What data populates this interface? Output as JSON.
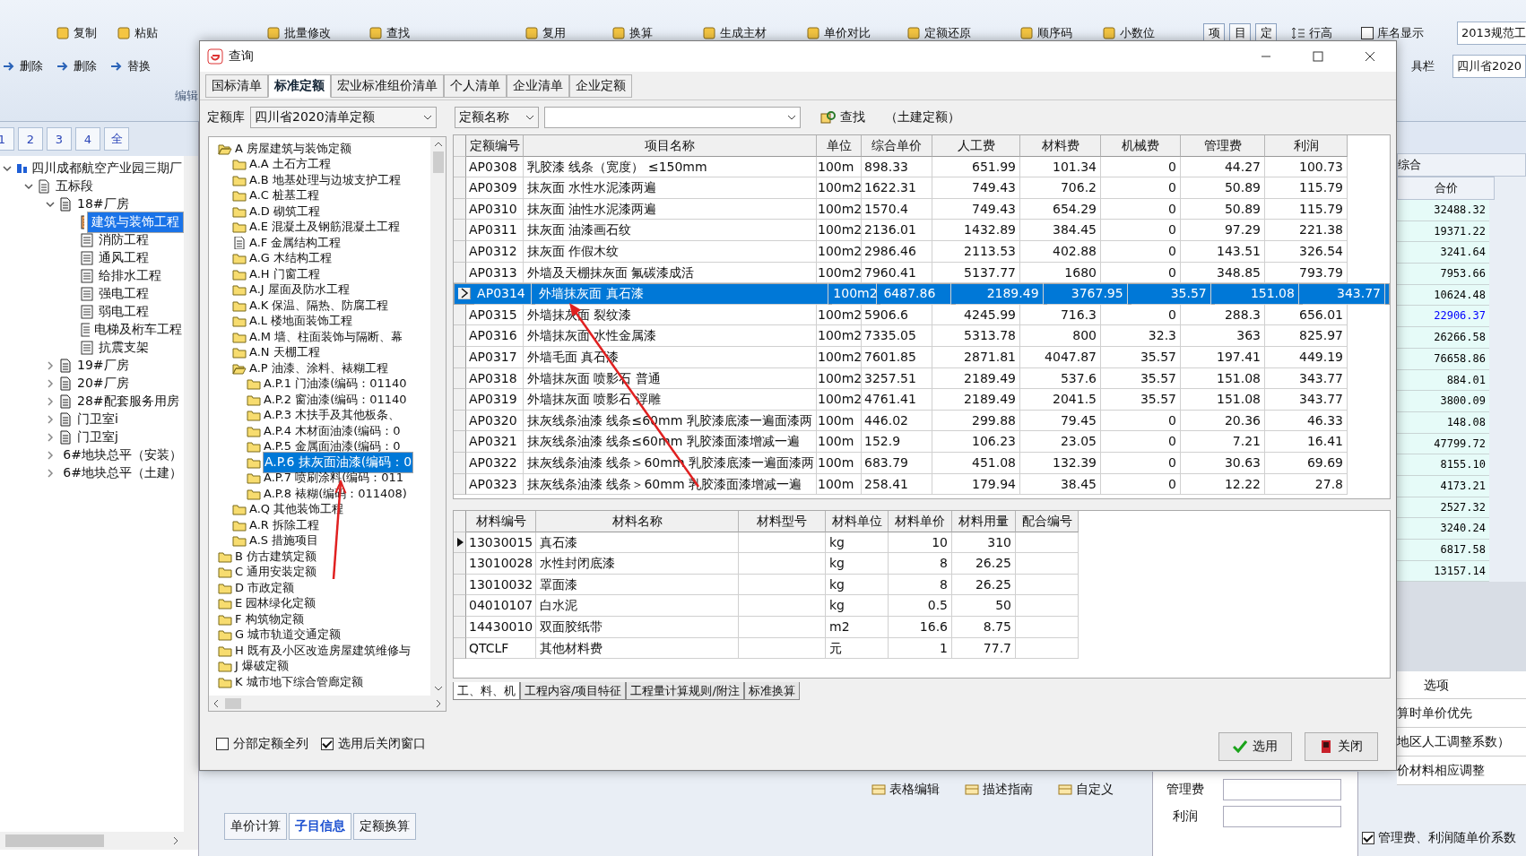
{
  "ribbon": {
    "row1": [
      {
        "label": "复制"
      },
      {
        "label": "粘贴"
      },
      {
        "label": "批量修改"
      },
      {
        "label": "查找"
      },
      {
        "label": "复用"
      },
      {
        "label": "换算"
      },
      {
        "label": "生成主材"
      },
      {
        "label": "单价对比"
      },
      {
        "label": "定额还原"
      },
      {
        "label": "顺序码"
      },
      {
        "label": "小数位"
      }
    ],
    "toggles": [
      "项",
      "目",
      "定"
    ],
    "row_height": "行高",
    "library_name_toggle": {
      "label": "库名显示",
      "checked": false
    },
    "standard_field": "2013规范工",
    "row2_left": [
      {
        "label": "删除"
      },
      {
        "label": "删除"
      },
      {
        "label": "替换"
      }
    ],
    "toolbar_label": "具栏",
    "region_field": "四川省2020",
    "group_label": "编辑"
  },
  "project_panel": {
    "tabs": [
      {
        "label": "1",
        "selected": false
      },
      {
        "label": "2",
        "selected": false
      },
      {
        "label": "3",
        "selected": false
      },
      {
        "label": "4",
        "selected": false
      },
      {
        "label": "全",
        "selected": false
      }
    ],
    "tree": [
      {
        "label": "四川成都航空产业园三期厂",
        "kind": "project",
        "expanded": true,
        "selected": false,
        "children": [
          {
            "label": "五标段",
            "kind": "section",
            "expanded": true,
            "selected": false,
            "children": [
              {
                "label": "18#厂房",
                "kind": "building",
                "expanded": true,
                "selected": false,
                "children": [
                  {
                    "label": "建筑与装饰工程",
                    "kind": "unit",
                    "selected": true
                  },
                  {
                    "label": "消防工程",
                    "kind": "unit",
                    "selected": false
                  },
                  {
                    "label": "通风工程",
                    "kind": "unit",
                    "selected": false
                  },
                  {
                    "label": "给排水工程",
                    "kind": "unit",
                    "selected": false
                  },
                  {
                    "label": "强电工程",
                    "kind": "unit",
                    "selected": false
                  },
                  {
                    "label": "弱电工程",
                    "kind": "unit",
                    "selected": false
                  },
                  {
                    "label": "电梯及桁车工程",
                    "kind": "unit",
                    "selected": false
                  },
                  {
                    "label": "抗震支架",
                    "kind": "unit",
                    "selected": false
                  }
                ]
              },
              {
                "label": "19#厂房",
                "kind": "building",
                "expanded": false,
                "selected": false
              },
              {
                "label": "20#厂房",
                "kind": "building",
                "expanded": false,
                "selected": false
              },
              {
                "label": "28#配套服务用房",
                "kind": "building",
                "expanded": false,
                "selected": false
              },
              {
                "label": "门卫室i",
                "kind": "building",
                "expanded": false,
                "selected": false
              },
              {
                "label": "门卫室j",
                "kind": "building",
                "expanded": false,
                "selected": false
              },
              {
                "label": "6#地块总平（安装）",
                "kind": "building",
                "expanded": false,
                "selected": false
              },
              {
                "label": "6#地块总平（土建）",
                "kind": "building",
                "expanded": false,
                "selected": false
              }
            ]
          }
        ]
      }
    ]
  },
  "summary_panel": {
    "group_header": "综合",
    "column_header": "合价",
    "values": [
      {
        "text": "32488.32",
        "color": "#000000"
      },
      {
        "text": "19371.22",
        "color": "#000000"
      },
      {
        "text": "3241.64",
        "color": "#000000"
      },
      {
        "text": "7953.66",
        "color": "#000000"
      },
      {
        "text": "10624.48",
        "color": "#000000"
      },
      {
        "text": "22906.37",
        "color": "#0000ff"
      },
      {
        "text": "26266.58",
        "color": "#000000"
      },
      {
        "text": "76658.86",
        "color": "#000000"
      },
      {
        "text": "884.01",
        "color": "#000000"
      },
      {
        "text": "3800.09",
        "color": "#000000"
      },
      {
        "text": "148.08",
        "color": "#000000"
      },
      {
        "text": "47799.72",
        "color": "#000000"
      },
      {
        "text": "8155.10",
        "color": "#000000"
      },
      {
        "text": "4173.21",
        "color": "#000000"
      },
      {
        "text": "2527.32",
        "color": "#000000"
      },
      {
        "text": "3240.24",
        "color": "#000000"
      },
      {
        "text": "6817.58",
        "color": "#000000"
      },
      {
        "text": "13157.14",
        "color": "#000000"
      }
    ],
    "options_header": "选项",
    "options": [
      "算时单价优先",
      "地区人工调整系数）",
      "价材料相应调整"
    ],
    "fees": [
      {
        "label": "管理费"
      },
      {
        "label": "利润"
      }
    ],
    "fee_option": {
      "label": "管理费、利润随单价系数",
      "checked": true
    }
  },
  "bottom_toolbar": [
    "表格编辑",
    "描述指南",
    "自定义"
  ],
  "bottom_tabs": [
    {
      "label": "单价计算",
      "selected": false
    },
    {
      "label": "子目信息",
      "selected": true
    },
    {
      "label": "定额换算",
      "selected": false
    }
  ],
  "dialog": {
    "title": "查询",
    "tabs": [
      {
        "label": "国标清单",
        "selected": false
      },
      {
        "label": "标准定额",
        "selected": true
      },
      {
        "label": "宏业标准组价清单",
        "selected": false
      },
      {
        "label": "个人清单",
        "selected": false
      },
      {
        "label": "企业清单",
        "selected": false
      },
      {
        "label": "企业定额",
        "selected": false
      }
    ],
    "library_label": "定额库",
    "library": "四川省2020清单定额",
    "search_by": "定额名称",
    "find_button": "查找",
    "scope": "（土建定额）",
    "tree": [
      {
        "label": "A 房屋建筑与装饰定额",
        "kind": "folder-open",
        "selected": false,
        "children": [
          {
            "label": "A.A 土石方工程",
            "kind": "folder",
            "selected": false
          },
          {
            "label": "A.B 地基处理与边坡支护工程",
            "kind": "folder",
            "selected": false
          },
          {
            "label": "A.C 桩基工程",
            "kind": "folder",
            "selected": false
          },
          {
            "label": "A.D 砌筑工程",
            "kind": "folder",
            "selected": false
          },
          {
            "label": "A.E 混凝土及钢筋混凝土工程",
            "kind": "folder",
            "selected": false
          },
          {
            "label": "A.F 金属结构工程",
            "kind": "document",
            "selected": false
          },
          {
            "label": "A.G 木结构工程",
            "kind": "folder",
            "selected": false
          },
          {
            "label": "A.H 门窗工程",
            "kind": "folder",
            "selected": false
          },
          {
            "label": "A.J 屋面及防水工程",
            "kind": "folder",
            "selected": false
          },
          {
            "label": "A.K 保温、隔热、防腐工程",
            "kind": "folder",
            "selected": false
          },
          {
            "label": "A.L 楼地面装饰工程",
            "kind": "folder",
            "selected": false
          },
          {
            "label": "A.M 墙、柱面装饰与隔断、幕",
            "kind": "folder",
            "selected": false
          },
          {
            "label": "A.N 天棚工程",
            "kind": "folder",
            "selected": false
          },
          {
            "label": "A.P 油漆、涂料、裱糊工程",
            "kind": "folder-open",
            "selected": false,
            "children": [
              {
                "label": "A.P.1 门油漆(编码：01140",
                "kind": "folder",
                "selected": false
              },
              {
                "label": "A.P.2 窗油漆(编码：01140",
                "kind": "folder",
                "selected": false
              },
              {
                "label": "A.P.3 木扶手及其他板条、",
                "kind": "folder",
                "selected": false
              },
              {
                "label": "A.P.4 木材面油漆(编码：0",
                "kind": "folder",
                "selected": false
              },
              {
                "label": "A.P.5 金属面油漆(编码：0",
                "kind": "folder",
                "selected": false
              },
              {
                "label": "A.P.6 抹灰面油漆(编码：0",
                "kind": "folder",
                "selected": true
              },
              {
                "label": "A.P.7 喷刷涂料(编码：011",
                "kind": "folder",
                "selected": false
              },
              {
                "label": "A.P.8 裱糊(编码：011408)",
                "kind": "folder",
                "selected": false
              }
            ]
          },
          {
            "label": "A.Q 其他装饰工程",
            "kind": "folder",
            "selected": false
          },
          {
            "label": "A.R 拆除工程",
            "kind": "folder",
            "selected": false
          },
          {
            "label": "A.S 措施项目",
            "kind": "folder",
            "selected": false
          }
        ]
      },
      {
        "label": "B 仿古建筑定额",
        "kind": "folder",
        "selected": false
      },
      {
        "label": "C 通用安装定额",
        "kind": "folder",
        "selected": false
      },
      {
        "label": "D 市政定额",
        "kind": "folder",
        "selected": false
      },
      {
        "label": "E 园林绿化定额",
        "kind": "folder",
        "selected": false
      },
      {
        "label": "F 构筑物定额",
        "kind": "folder",
        "selected": false
      },
      {
        "label": "G 城市轨道交通定额",
        "kind": "folder",
        "selected": false
      },
      {
        "label": "H 既有及小区改造房屋建筑维修与",
        "kind": "folder",
        "selected": false
      },
      {
        "label": "J 爆破定额",
        "kind": "folder",
        "selected": false
      },
      {
        "label": "K 城市地下综合管廊定额",
        "kind": "folder",
        "selected": false
      }
    ],
    "quota_columns": [
      "定额编号",
      "项目名称",
      "单位",
      "综合单价",
      "人工费",
      "材料费",
      "机械费",
      "管理费",
      "利润"
    ],
    "quota_rows": [
      {
        "code": "AP0308",
        "name": "乳胶漆 线条（宽度） ≤150mm",
        "unit": "100m",
        "price": "898.33",
        "labor": "651.99",
        "material": "101.34",
        "machine": "0",
        "mgmt": "44.27",
        "profit": "100.73",
        "selected": false
      },
      {
        "code": "AP0309",
        "name": "抹灰面 水性水泥漆两遍",
        "unit": "100m2",
        "price": "1622.31",
        "labor": "749.43",
        "material": "706.2",
        "machine": "0",
        "mgmt": "50.89",
        "profit": "115.79",
        "selected": false
      },
      {
        "code": "AP0310",
        "name": "抹灰面 油性水泥漆两遍",
        "unit": "100m2",
        "price": "1570.4",
        "labor": "749.43",
        "material": "654.29",
        "machine": "0",
        "mgmt": "50.89",
        "profit": "115.79",
        "selected": false
      },
      {
        "code": "AP0311",
        "name": "抹灰面 油漆画石纹",
        "unit": "100m2",
        "price": "2136.01",
        "labor": "1432.89",
        "material": "384.45",
        "machine": "0",
        "mgmt": "97.29",
        "profit": "221.38",
        "selected": false
      },
      {
        "code": "AP0312",
        "name": "抹灰面 作假木纹",
        "unit": "100m2",
        "price": "2986.46",
        "labor": "2113.53",
        "material": "402.88",
        "machine": "0",
        "mgmt": "143.51",
        "profit": "326.54",
        "selected": false
      },
      {
        "code": "AP0313",
        "name": "外墙及天棚抹灰面 氟碳漆成活",
        "unit": "100m2",
        "price": "7960.41",
        "labor": "5137.77",
        "material": "1680",
        "machine": "0",
        "mgmt": "348.85",
        "profit": "793.79",
        "selected": false
      },
      {
        "code": "AP0314",
        "name": "外墙抹灰面 真石漆",
        "unit": "100m2",
        "price": "6487.86",
        "labor": "2189.49",
        "material": "3767.95",
        "machine": "35.57",
        "mgmt": "151.08",
        "profit": "343.77",
        "selected": true
      },
      {
        "code": "AP0315",
        "name": "外墙抹灰面 裂纹漆",
        "unit": "100m2",
        "price": "5906.6",
        "labor": "4245.99",
        "material": "716.3",
        "machine": "0",
        "mgmt": "288.3",
        "profit": "656.01",
        "selected": false
      },
      {
        "code": "AP0316",
        "name": "外墙抹灰面 水性金属漆",
        "unit": "100m2",
        "price": "7335.05",
        "labor": "5313.78",
        "material": "800",
        "machine": "32.3",
        "mgmt": "363",
        "profit": "825.97",
        "selected": false
      },
      {
        "code": "AP0317",
        "name": "外墙毛面 真石漆",
        "unit": "100m2",
        "price": "7601.85",
        "labor": "2871.81",
        "material": "4047.87",
        "machine": "35.57",
        "mgmt": "197.41",
        "profit": "449.19",
        "selected": false
      },
      {
        "code": "AP0318",
        "name": "外墙抹灰面 喷影石 普通",
        "unit": "100m2",
        "price": "3257.51",
        "labor": "2189.49",
        "material": "537.6",
        "machine": "35.57",
        "mgmt": "151.08",
        "profit": "343.77",
        "selected": false
      },
      {
        "code": "AP0319",
        "name": "外墙抹灰面 喷影石 浮雕",
        "unit": "100m2",
        "price": "4761.41",
        "labor": "2189.49",
        "material": "2041.5",
        "machine": "35.57",
        "mgmt": "151.08",
        "profit": "343.77",
        "selected": false
      },
      {
        "code": "AP0320",
        "name": "抹灰线条油漆 线条≤60mm 乳胶漆底漆一遍面漆两",
        "unit": "100m",
        "price": "446.02",
        "labor": "299.88",
        "material": "79.45",
        "machine": "0",
        "mgmt": "20.36",
        "profit": "46.33",
        "selected": false
      },
      {
        "code": "AP0321",
        "name": "抹灰线条油漆 线条≤60mm 乳胶漆面漆增减一遍",
        "unit": "100m",
        "price": "152.9",
        "labor": "106.23",
        "material": "23.05",
        "machine": "0",
        "mgmt": "7.21",
        "profit": "16.41",
        "selected": false
      },
      {
        "code": "AP0322",
        "name": "抹灰线条油漆 线条＞60mm 乳胶漆底漆一遍面漆两",
        "unit": "100m",
        "price": "683.79",
        "labor": "451.08",
        "material": "132.39",
        "machine": "0",
        "mgmt": "30.63",
        "profit": "69.69",
        "selected": false
      },
      {
        "code": "AP0323",
        "name": "抹灰线条油漆 线条＞60mm 乳胶漆面漆增减一遍",
        "unit": "100m",
        "price": "258.41",
        "labor": "179.94",
        "material": "38.45",
        "machine": "0",
        "mgmt": "12.22",
        "profit": "27.8",
        "selected": false
      }
    ],
    "material_columns": [
      "材料编号",
      "材料名称",
      "材料型号",
      "材料单位",
      "材料单价",
      "材料用量",
      "配合编号"
    ],
    "material_rows": [
      {
        "code": "13030015",
        "name": "真石漆",
        "unit": "kg",
        "price": "10",
        "qty": "310",
        "selected": true
      },
      {
        "code": "13010028",
        "name": "水性封闭底漆",
        "unit": "kg",
        "price": "8",
        "qty": "26.25",
        "selected": false
      },
      {
        "code": "13010032",
        "name": "罩面漆",
        "unit": "kg",
        "price": "8",
        "qty": "26.25",
        "selected": false
      },
      {
        "code": "04010107",
        "name": "白水泥",
        "unit": "kg",
        "price": "0.5",
        "qty": "50",
        "selected": false
      },
      {
        "code": "14430010",
        "name": "双面胶纸带",
        "unit": "m2",
        "price": "16.6",
        "qty": "8.75",
        "selected": false
      },
      {
        "code": "QTCLF",
        "name": "其他材料费",
        "unit": "元",
        "price": "1",
        "qty": "77.7",
        "selected": false
      }
    ],
    "detail_tabs": [
      {
        "label": "工、料、机",
        "selected": true
      },
      {
        "label": "工程内容/项目特征",
        "selected": false
      },
      {
        "label": "工程量计算规则/附注",
        "selected": false
      },
      {
        "label": "标准换算",
        "selected": false
      }
    ],
    "options": [
      {
        "label": "分部定额全列",
        "checked": false
      },
      {
        "label": "选用后关闭窗口",
        "checked": true
      }
    ],
    "select_button": "选用",
    "close_button": "关闭"
  }
}
